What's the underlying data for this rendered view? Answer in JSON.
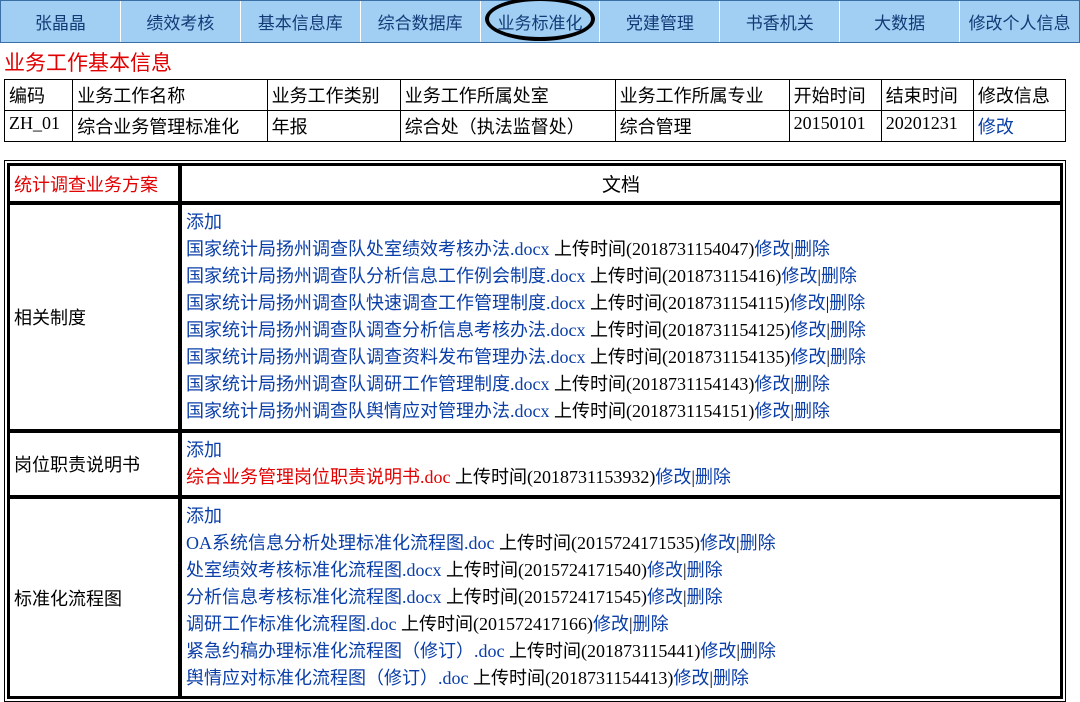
{
  "topnav": [
    "张晶晶",
    "绩效考核",
    "基本信息库",
    "综合数据库",
    "业务标准化",
    "党建管理",
    "书香机关",
    "大数据",
    "修改个人信息"
  ],
  "circledIndex": 4,
  "title1": "业务工作基本信息",
  "info_headers": [
    "编码",
    "业务工作名称",
    "业务工作类别",
    "业务工作所属处室",
    "业务工作所属专业",
    "开始时间",
    "结束时间",
    "修改信息"
  ],
  "info_row": {
    "code": "ZH_01",
    "name": "综合业务管理标准化",
    "type": "年报",
    "dept": "综合处（执法监督处）",
    "spec": "综合管理",
    "start": "20150101",
    "end": "20201231",
    "edit": "修改"
  },
  "docs_title_left": "统计调查业务方案",
  "docs_title_right": "文档",
  "add_label": "添加",
  "upload_prefix": "上传时间",
  "action_edit": "修改",
  "action_del": "删除",
  "sections": [
    {
      "label": "相关制度",
      "files": [
        {
          "name": "国家统计局扬州调查队处室绩效考核办法.docx",
          "time": "2018731154047"
        },
        {
          "name": "国家统计局扬州调查队分析信息工作例会制度.docx",
          "time": "20187311541​6",
          "rawtime": "20187311541​6"
        },
        {
          "name": "国家统计局扬州调查队快速调查工作管理制度.docx",
          "time": "2018731154115"
        },
        {
          "name": "国家统计局扬州调查队调查分析信息考核办法.docx",
          "time": "2018731154125"
        },
        {
          "name": "国家统计局扬州调查队调查资料发布管理办法.docx",
          "time": "2018731154135"
        },
        {
          "name": "国家统计局扬州调查队调研工作管理制度.docx",
          "time": "2018731154143"
        },
        {
          "name": "国家统计局扬州调查队舆情应对管理办法.docx",
          "time": "2018731154151"
        }
      ]
    },
    {
      "label": "岗位职责说明书",
      "files": [
        {
          "name": "综合业务管理岗位职责说明书.doc",
          "time": "2018731153932",
          "red": true
        }
      ]
    },
    {
      "label": "标准化流程图",
      "files": [
        {
          "name": "OA系统信息分析处理标准化流程图.doc",
          "time": "2015724171535"
        },
        {
          "name": "处室绩效考核标准化流程图.docx",
          "time": "2015724171540"
        },
        {
          "name": "分析信息考核标准化流程图.docx",
          "time": "2015724171545"
        },
        {
          "name": "调研工作标准化流程图.doc",
          "time": "201572417166"
        },
        {
          "name": "紧急约稿办理标准化流程图（修订）.doc",
          "time": "20187311544​1",
          "rawtime": "20187311544​1"
        },
        {
          "name": "舆情应对标准化流程图（修订）.doc",
          "time": "2018731154413"
        }
      ]
    }
  ],
  "fix_times": {
    "sections.0.files.1.time": "20187311541​6",
    "sections.2.files.4.time": "20187311544​1"
  },
  "actual_times_override": {
    "0_1": "20187311541​6",
    "2_4": "20187311544​1"
  },
  "override_fix": [
    [
      "0",
      "1",
      "20187311541",
      "6"
    ],
    [
      "2",
      "4",
      "20187311544",
      "1"
    ]
  ],
  "real_times": {
    "0": [
      "2018731154047",
      "20187311541_6",
      "2018731154115",
      "2018731154125",
      "2018731154135",
      "2018731154143",
      "2018731154151"
    ],
    "2": [
      "2015724171535",
      "2015724171540",
      "2015724171545",
      "201572417166",
      "20187311544_1",
      "2018731154413"
    ]
  },
  "time_literal": {
    "s0f1": "201873115416",
    "s2f4": "20187311544​1"
  },
  "corrections": {}
}
